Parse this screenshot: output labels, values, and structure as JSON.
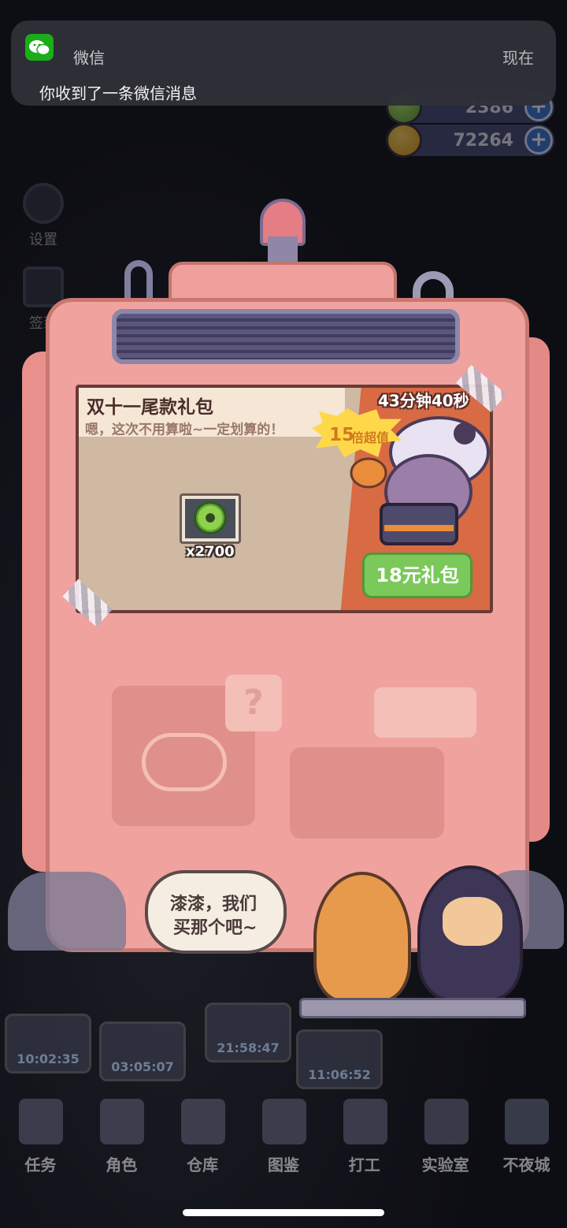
{
  "notification": {
    "app_name": "微信",
    "time": "现在",
    "message": "你收到了一条微信消息"
  },
  "currencies": [
    {
      "value": "2386",
      "icon": "gem-icon"
    },
    {
      "value": "72264",
      "icon": "coin-icon"
    }
  ],
  "side_menu": [
    {
      "label": "设置",
      "icon": "gear-icon"
    },
    {
      "label": "签到",
      "icon": "calendar-icon"
    }
  ],
  "gift_pack": {
    "title": "双十一尾款礼包",
    "subtitle": "嗯，这次不用算啦~一定划算的！",
    "countdown": "43分钟40秒",
    "value_multiplier": "15",
    "value_label": "倍超值",
    "item_quantity": "x2700",
    "item_icon": "donut-icon",
    "buy_label": "18元礼包"
  },
  "speech": {
    "line1": "漆漆，我们",
    "line2": "买那个吧~"
  },
  "placeholder_icon": "?",
  "timers": [
    "10:02:35",
    "03:05:07",
    "21:58:47",
    "11:06:52"
  ],
  "nav": [
    {
      "label": "任务",
      "icon": "task-icon"
    },
    {
      "label": "角色",
      "icon": "character-icon"
    },
    {
      "label": "仓库",
      "icon": "warehouse-icon"
    },
    {
      "label": "图鉴",
      "icon": "book-icon"
    },
    {
      "label": "打工",
      "icon": "work-icon"
    },
    {
      "label": "实验室",
      "icon": "lab-icon"
    },
    {
      "label": "不夜城",
      "icon": "city-icon"
    }
  ],
  "colors": {
    "accent_green": "#7bc95a",
    "panel_orange": "#d86a44",
    "machine_pink": "#f0a29e"
  }
}
